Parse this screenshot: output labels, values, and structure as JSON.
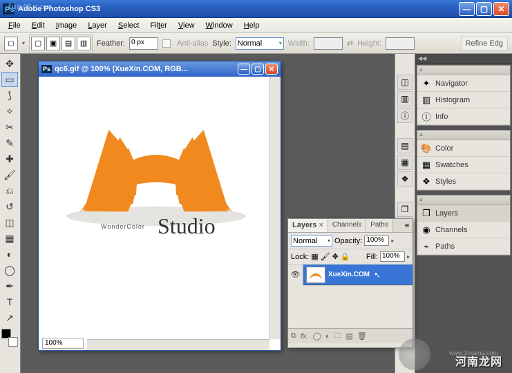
{
  "app": {
    "title": "Adobe Photoshop CS3",
    "watermark_tl": "fun48.com"
  },
  "menus": [
    "File",
    "Edit",
    "Image",
    "Layer",
    "Select",
    "Filter",
    "View",
    "Window",
    "Help"
  ],
  "options": {
    "feather_label": "Feather:",
    "feather_value": "0 px",
    "antialias_label": "Anti-alias",
    "style_label": "Style:",
    "style_value": "Normal",
    "width_label": "Width:",
    "height_label": "Height:",
    "refine_label": "Refine Edg"
  },
  "document": {
    "title": "qc6.gif @ 100% (XueXin.COM, RGB...",
    "zoom": "100%",
    "logo_small": "WonderColor",
    "logo_script": "Studio"
  },
  "panels": {
    "nav": [
      {
        "icon": "✦",
        "label": "Navigator"
      },
      {
        "icon": "▥",
        "label": "Histogram"
      },
      {
        "icon": "ⓘ",
        "label": "Info"
      }
    ],
    "color": [
      {
        "icon": "🎨",
        "label": "Color"
      },
      {
        "icon": "▦",
        "label": "Swatches"
      },
      {
        "icon": "❖",
        "label": "Styles"
      }
    ],
    "layers": [
      {
        "icon": "❐",
        "label": "Layers",
        "active": true
      },
      {
        "icon": "◉",
        "label": "Channels"
      },
      {
        "icon": "⌁",
        "label": "Paths"
      }
    ]
  },
  "layers_panel": {
    "tabs": [
      "Layers",
      "Channels",
      "Paths"
    ],
    "blend_mode": "Normal",
    "opacity_label": "Opacity:",
    "opacity_value": "100%",
    "lock_label": "Lock:",
    "fill_label": "Fill:",
    "fill_value": "100%",
    "layer_name": "XueXin.COM"
  },
  "watermark": {
    "text": "河南龙网",
    "url": "www.3mama.com"
  }
}
